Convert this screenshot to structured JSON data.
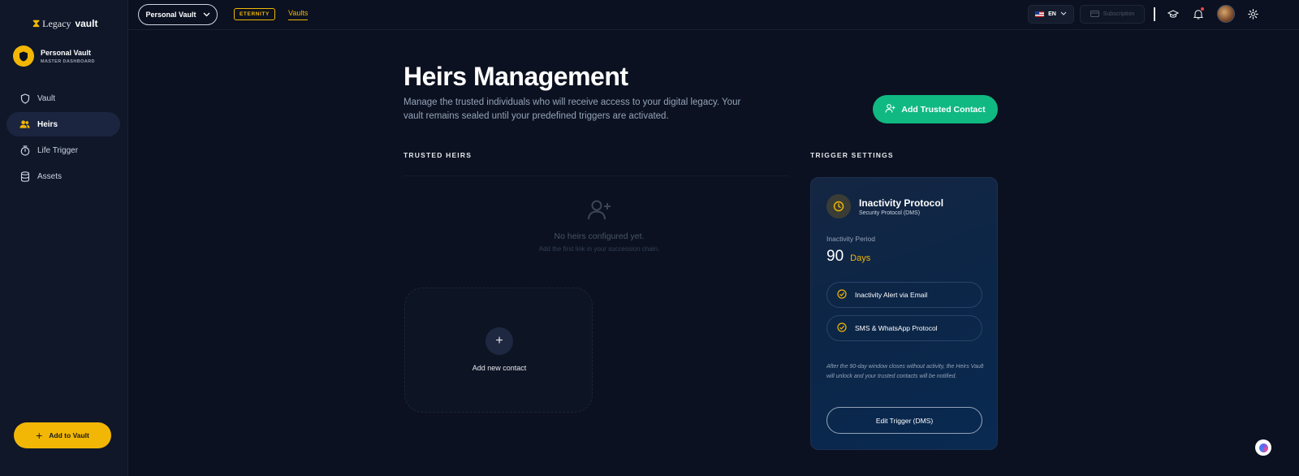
{
  "brand": {
    "legacy": "Legacy",
    "vault": "vault"
  },
  "vault_card": {
    "name": "Personal Vault",
    "subtitle": "MASTER DASHBOARD"
  },
  "sidebar": {
    "items": [
      {
        "label": "Vault",
        "icon": "shield-icon",
        "active": false
      },
      {
        "label": "Heirs",
        "icon": "users-icon",
        "active": true
      },
      {
        "label": "Life Trigger",
        "icon": "stopwatch-icon",
        "active": false
      },
      {
        "label": "Assets",
        "icon": "database-icon",
        "active": false
      }
    ],
    "add_button": "Add to Vault"
  },
  "topbar": {
    "vault_select": "Personal Vault",
    "plan_badge": "ETERNITY",
    "vaults_link": "Vaults",
    "language": "EN",
    "subscription": "Subscription"
  },
  "page": {
    "title": "Heirs Management",
    "subtitle": "Manage the trusted individuals who will receive access to your digital legacy. Your vault remains sealed until your predefined triggers are activated.",
    "add_trusted_contact": "Add Trusted Contact"
  },
  "heirs": {
    "section_label": "TRUSTED HEIRS",
    "empty_title": "No heirs configured yet.",
    "empty_subtitle": "Add the first link in your succession chain.",
    "add_contact_label": "Add new contact"
  },
  "trigger": {
    "section_label": "TRIGGER SETTINGS",
    "title": "Inactivity Protocol",
    "subtitle": "Security Protocol (DMS)",
    "period_label": "Inactivity Period",
    "period_value": "90",
    "period_unit": "Days",
    "options": [
      "Inactivity Alert via Email",
      "SMS & WhatsApp Protocol"
    ],
    "note": "After the 90-day window closes without activity, the Heirs Vault will unlock and your trusted contacts will be notified.",
    "edit_button": "Edit Trigger (DMS)"
  },
  "colors": {
    "accent_gold": "#f2b705",
    "accent_green": "#10b981",
    "background": "#0b1120"
  }
}
